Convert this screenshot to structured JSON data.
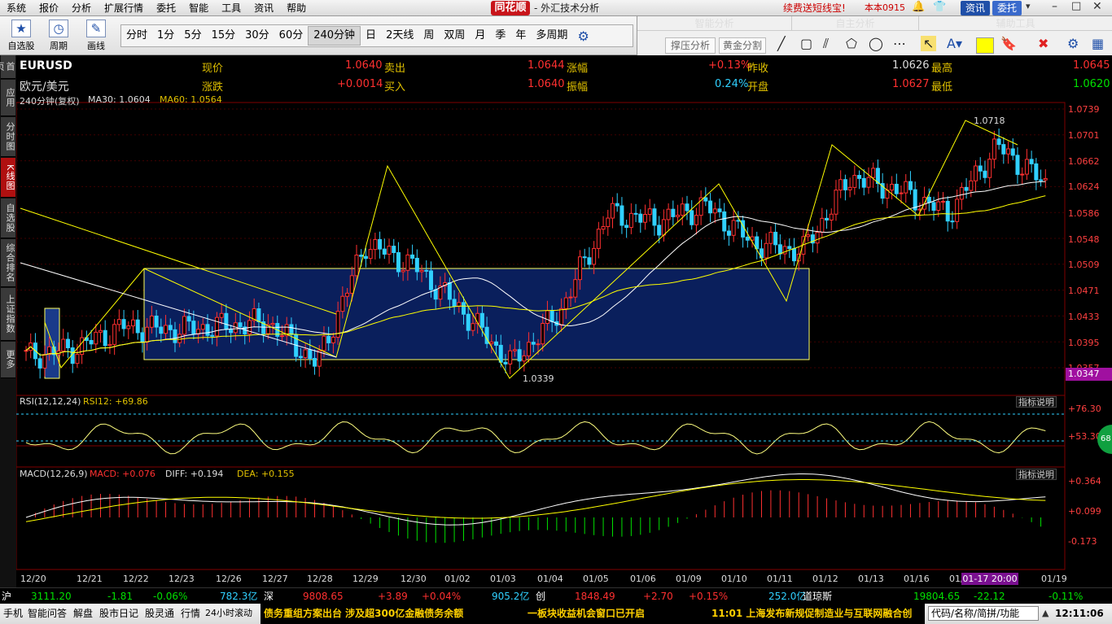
{
  "menu": [
    "系统",
    "报价",
    "分析",
    "扩展行情",
    "委托",
    "智能",
    "工具",
    "资讯",
    "帮助"
  ],
  "brand": "同花顺",
  "app_title": "- 外汇技术分析",
  "promo": "续费送短线宝!",
  "version": "本本0915",
  "top_buttons": {
    "news": "资讯",
    "trade": "委托"
  },
  "toolbar": {
    "self_select": "自选股",
    "period": "周期",
    "draw": "画线",
    "periods": [
      "分时",
      "1分",
      "5分",
      "15分",
      "30分",
      "60分",
      "240分钟",
      "日",
      "2天线",
      "周",
      "双周",
      "月",
      "季",
      "年",
      "多周期"
    ],
    "selected_period": "240分钟"
  },
  "panel": {
    "tabs": [
      "智能分析",
      "自主分析",
      "辅助工具"
    ],
    "btn_pressure": "撑压分析",
    "btn_golden": "黄金分割"
  },
  "side_tabs": [
    "首页",
    "应用",
    "分时图",
    "K线图",
    "自选股",
    "综合排名",
    "上证指数",
    "更多"
  ],
  "side_selected": "K线图",
  "quote": {
    "code": "EURUSD",
    "name": "欧元/美元",
    "now_label": "现价",
    "now": "1.0640",
    "sell_label": "卖出",
    "sell": "1.0644",
    "range_label": "涨幅",
    "range": "+0.13%",
    "prev_label": "昨收",
    "prev": "1.0626",
    "high_label": "最高",
    "high": "1.0645",
    "chg_label": "涨跌",
    "chg": "+0.0014",
    "buy_label": "买入",
    "buy": "1.0640",
    "amp_label": "振幅",
    "amp": "0.24%",
    "open_label": "开盘",
    "open": "1.0627",
    "low_label": "最低",
    "low": "1.0620"
  },
  "main_indicator": {
    "period": "240分钟(复权)",
    "ma30": "MA30: 1.0604",
    "ma60": "MA60: 1.0564"
  },
  "annot_high": "1.0718",
  "annot_low": "1.0339",
  "price_axis": [
    "1.0739",
    "1.0701",
    "1.0662",
    "1.0624",
    "1.0586",
    "1.0548",
    "1.0509",
    "1.0471",
    "1.0433",
    "1.0395",
    "1.0357"
  ],
  "current_price_tag": "1.0347",
  "rsi": {
    "label": "RSI(12,12,24)",
    "value": "RSI12: +69.86",
    "help": "指标说明",
    "axis": [
      "+76.30",
      "+53.30"
    ],
    "badge": "68"
  },
  "macd": {
    "label": "MACD(12,26,9)",
    "macd": "MACD: +0.076",
    "diff": "DIFF: +0.194",
    "dea": "DEA: +0.155",
    "help": "指标说明",
    "axis": [
      "+0.364",
      "+0.099",
      "-0.173"
    ]
  },
  "x_dates": [
    "12/20",
    "12/21",
    "12/22",
    "12/23",
    "12/26",
    "12/27",
    "12/28",
    "12/29",
    "12/30",
    "01/02",
    "01/03",
    "01/04",
    "01/05",
    "01/06",
    "01/09",
    "01/10",
    "01/11",
    "01/12",
    "01/13",
    "01/16",
    "01/",
    "01/19"
  ],
  "cursor_date": "01-17 20:00",
  "status": {
    "sh_label": "沪",
    "sh": "3111.20",
    "sh_chg": "-1.81",
    "sh_pct": "-0.06%",
    "sh_amt": "782.3亿",
    "sz_label": "深",
    "sz": "9808.65",
    "sz_chg": "+3.89",
    "sz_pct": "+0.04%",
    "sz_amt": "905.2亿",
    "cy_label": "创",
    "cy": "1848.49",
    "cy_chg": "+2.70",
    "cy_pct": "+0.15%",
    "cy_amt": "252.0亿",
    "dj_label": "道琼斯",
    "dj": "19804.65",
    "dj_chg": "-22.12",
    "dj_pct": "-0.11%"
  },
  "bottom": {
    "items": [
      "手机",
      "智能问答",
      "解盘",
      "股市日记",
      "股灵通",
      "行情",
      "24小时滚动"
    ],
    "news1": "债务重组方案出台 涉及超300亿金融债务余额",
    "news2": "一板块收益机会窗口已开启",
    "news3": "11:01 上海发布新规促制造业与互联网融合创",
    "search": "代码/名称/简拼/功能",
    "clock": "12:11:06"
  },
  "colors": {
    "up": "#ff3030",
    "down": "#30d0ff",
    "box": "#0a1f5c",
    "line": "#ffff00",
    "ma": "#ffffff"
  },
  "chart_data": {
    "type": "candlestick",
    "title": "EURUSD",
    "x": [
      "12/20",
      "12/21",
      "12/22",
      "12/23",
      "12/26",
      "12/27",
      "12/28",
      "12/29",
      "12/30",
      "01/02",
      "01/03",
      "01/04",
      "01/05",
      "01/06",
      "01/09",
      "01/10",
      "01/11",
      "01/12",
      "01/13",
      "01/16",
      "01/17",
      "01/19"
    ],
    "close": [
      1.041,
      1.042,
      1.045,
      1.0445,
      1.045,
      1.0455,
      1.04,
      1.056,
      1.053,
      1.047,
      1.04,
      1.047,
      1.06,
      1.059,
      1.061,
      1.056,
      1.055,
      1.065,
      1.063,
      1.06,
      1.069,
      1.064
    ],
    "ylim": [
      1.0339,
      1.0739
    ],
    "ma_labels": [
      "MA30",
      "MA60"
    ]
  }
}
